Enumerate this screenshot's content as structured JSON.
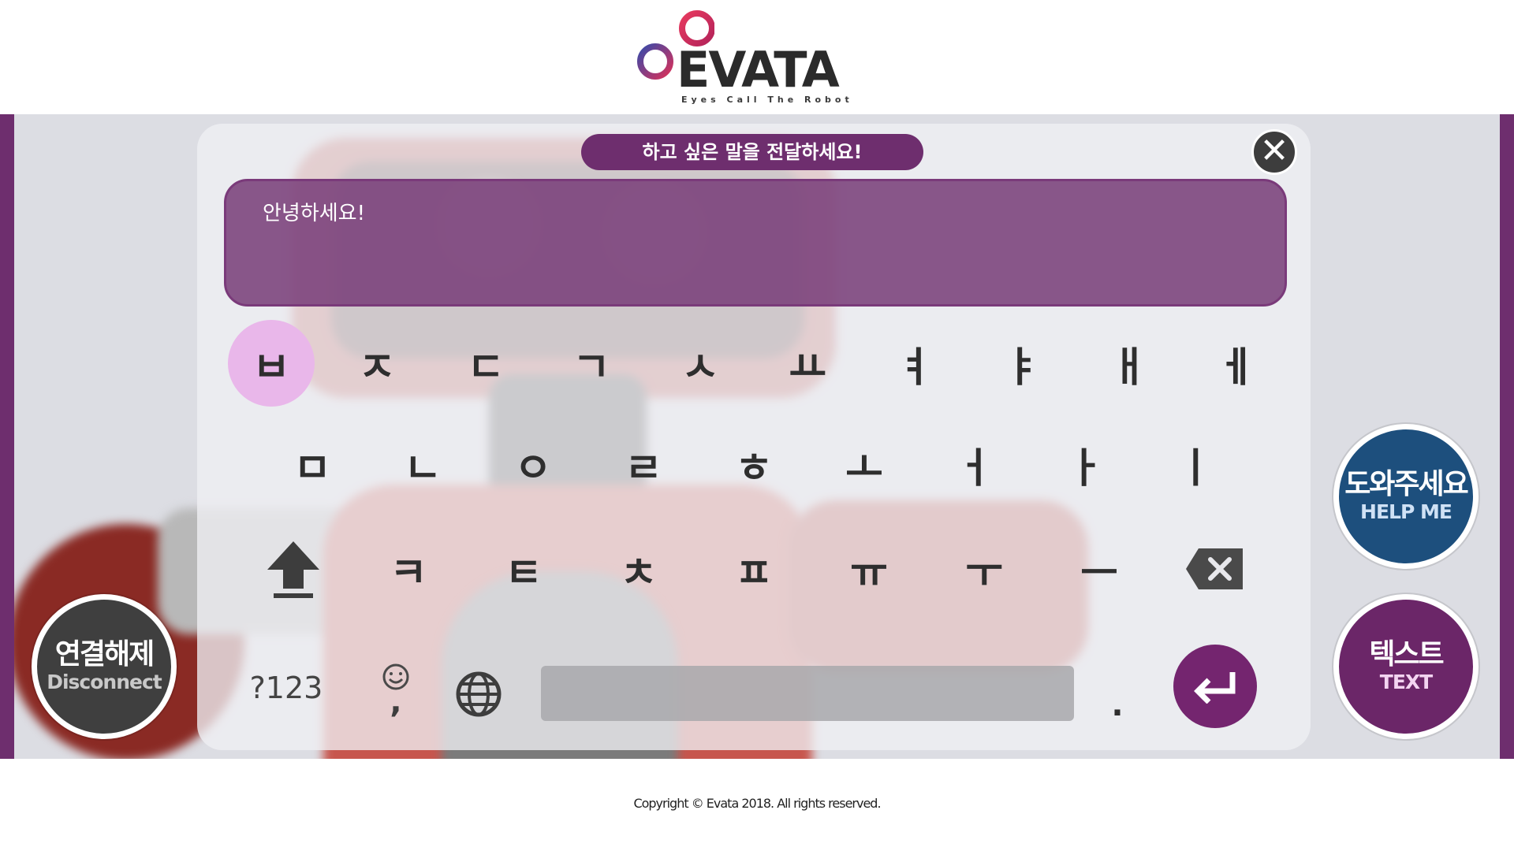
{
  "header": {
    "logo_text": "EVATA",
    "logo_tagline": "Eyes Call The Robot"
  },
  "prompt": {
    "label": "하고 싶은 말을 전달하세요!"
  },
  "input": {
    "value": "안녕하세요!"
  },
  "keyboard": {
    "row1": [
      "ㅂ",
      "ㅈ",
      "ㄷ",
      "ㄱ",
      "ㅅ",
      "ㅛ",
      "ㅕ",
      "ㅑ",
      "ㅐ",
      "ㅔ"
    ],
    "row2": [
      "ㅁ",
      "ㄴ",
      "ㅇ",
      "ㄹ",
      "ㅎ",
      "ㅗ",
      "ㅓ",
      "ㅏ",
      "ㅣ"
    ],
    "row3": [
      "ㅋ",
      "ㅌ",
      "ㅊ",
      "ㅍ",
      "ㅠ",
      "ㅜ",
      "ㅡ"
    ],
    "symbols_key": "?123",
    "comma_key": ",",
    "period_key": ".",
    "active_key": "ㅂ"
  },
  "buttons": {
    "disconnect_ko": "연결해제",
    "disconnect_en": "Disconnect",
    "help_ko": "도와주세요",
    "help_en": "HELP ME",
    "text_ko": "텍스트",
    "text_en": "TEXT"
  },
  "footer": {
    "copyright": "Copyright © Evata 2018. All rights reserved."
  },
  "colors": {
    "brand_purple": "#6e2e6e",
    "help_blue": "#1d4f7d",
    "disconnect_gray": "#3f3f3f",
    "active_key_pink": "#e9b7ea"
  }
}
